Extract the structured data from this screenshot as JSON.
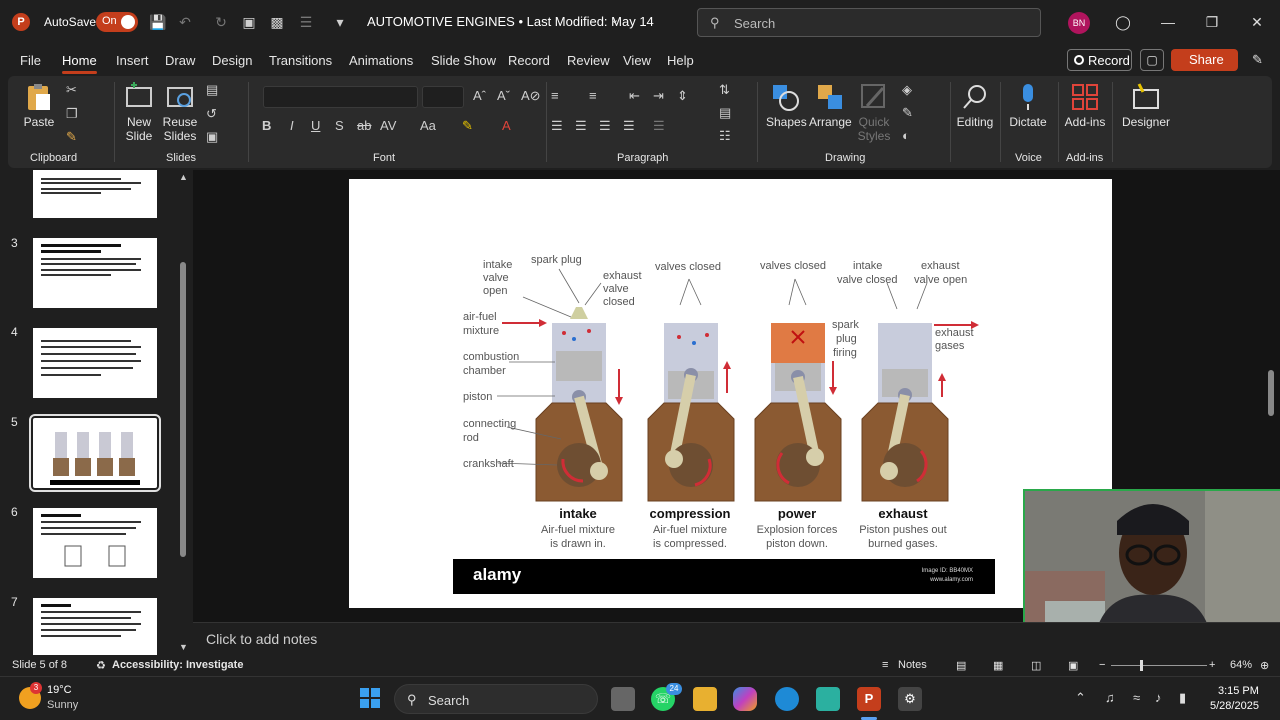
{
  "titlebar": {
    "app_icon": "P",
    "autosave_label": "AutoSave",
    "autosave_state": "On",
    "doc_title": "AUTOMOTIVE ENGINES • Last Modified: May 14",
    "search_placeholder": "Search",
    "avatar_initials": "BN",
    "icons": [
      "save-icon",
      "undo-icon",
      "redo-icon",
      "present-icon",
      "find-icon",
      "list-icon",
      "customize-icon",
      "lightbulb-icon",
      "minimize-icon",
      "restore-icon",
      "close-icon"
    ]
  },
  "menubar": {
    "items": [
      "File",
      "Home",
      "Insert",
      "Draw",
      "Design",
      "Transitions",
      "Animations",
      "Slide Show",
      "Record",
      "Review",
      "View",
      "Help"
    ],
    "active": "Home",
    "record_label": "Record",
    "share_label": "Share"
  },
  "ribbon": {
    "groups": {
      "clipboard": "Clipboard",
      "slides": "Slides",
      "font": "Font",
      "paragraph": "Paragraph",
      "drawing": "Drawing",
      "voice": "Voice",
      "addins": "Add-ins"
    },
    "buttons": {
      "paste": "Paste",
      "new_slide_1": "New",
      "new_slide_2": "Slide",
      "reuse_1": "Reuse",
      "reuse_2": "Slides",
      "shapes": "Shapes",
      "arrange": "Arrange",
      "quick_styles_1": "Quick",
      "quick_styles_2": "Styles",
      "editing": "Editing",
      "dictate": "Dictate",
      "addins": "Add-ins",
      "designer": "Designer"
    },
    "font_buttons": [
      "B",
      "I",
      "U",
      "S",
      "ab",
      "AV",
      "Aa"
    ]
  },
  "thumbnails": [
    {
      "number": "",
      "selected": false
    },
    {
      "number": "3",
      "selected": false
    },
    {
      "number": "4",
      "selected": false
    },
    {
      "number": "5",
      "selected": true
    },
    {
      "number": "6",
      "selected": false
    },
    {
      "number": "7",
      "selected": false
    }
  ],
  "slide": {
    "labels_left": {
      "intake_valve": [
        "intake",
        "valve",
        "open"
      ],
      "spark_plug": "spark plug",
      "exhaust_valve": [
        "exhaust",
        "valve",
        "closed"
      ],
      "air_fuel": [
        "air-fuel",
        "mixture"
      ],
      "combustion": [
        "combustion",
        "chamber"
      ],
      "piston": "piston",
      "connecting_rod": [
        "connecting",
        "rod"
      ],
      "crankshaft": "crankshaft"
    },
    "labels_top": {
      "valves_closed_1": "valves closed",
      "valves_closed_2": "valves closed",
      "intake_valve_closed": [
        "intake",
        "valve closed"
      ],
      "exhaust_valve_open": [
        "exhaust",
        "valve open"
      ],
      "spark_plug_firing": [
        "spark",
        "plug",
        "firing"
      ],
      "exhaust_gases": [
        "exhaust",
        "gases"
      ]
    },
    "strokes": [
      {
        "name": "intake",
        "desc": [
          "Air-fuel mixture",
          "is drawn in."
        ]
      },
      {
        "name": "compression",
        "desc": [
          "Air-fuel mixture",
          "is compressed."
        ]
      },
      {
        "name": "power",
        "desc": [
          "Explosion forces",
          "piston down."
        ]
      },
      {
        "name": "exhaust",
        "desc": [
          "Piston pushes out",
          "burned gases."
        ]
      }
    ],
    "banner_logo": "alamy",
    "banner_id": [
      "Image ID: BB40MX",
      "www.alamy.com"
    ]
  },
  "notes_placeholder": "Click to add notes",
  "statusbar": {
    "slide_info": "Slide 5 of 8",
    "accessibility": "Accessibility: Investigate",
    "notes": "Notes",
    "zoom": "64%",
    "zoom_level": 0.64
  },
  "taskbar": {
    "weather_temp": "19°C",
    "weather_desc": "Sunny",
    "weather_badge": "3",
    "search_placeholder": "Search",
    "whatsapp_badge": "24",
    "time": "3:15 PM",
    "date": "5/28/2025"
  },
  "colors": {
    "accent": "#c43e1c",
    "ribbon_bg": "#2b2b2b",
    "app_bg": "#1f1f1f"
  }
}
